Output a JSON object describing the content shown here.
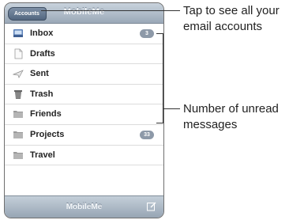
{
  "nav": {
    "back_label": "Accounts",
    "title": "MobileMe"
  },
  "mailboxes": [
    {
      "label": "Inbox",
      "icon": "inbox-icon",
      "badge": "3"
    },
    {
      "label": "Drafts",
      "icon": "drafts-icon",
      "badge": ""
    },
    {
      "label": "Sent",
      "icon": "sent-icon",
      "badge": ""
    },
    {
      "label": "Trash",
      "icon": "trash-icon",
      "badge": ""
    },
    {
      "label": "Friends",
      "icon": "folder-icon",
      "badge": ""
    },
    {
      "label": "Projects",
      "icon": "folder-icon",
      "badge": "33"
    },
    {
      "label": "Travel",
      "icon": "folder-icon",
      "badge": ""
    }
  ],
  "bottom": {
    "title": "MobileMe"
  },
  "callouts": {
    "accounts": "Tap to see all your email accounts",
    "unread": "Number of unread messages"
  },
  "colors": {
    "badge": "#8d99a8",
    "navbar": "#9aa8b7",
    "back_button": "#52667f"
  }
}
